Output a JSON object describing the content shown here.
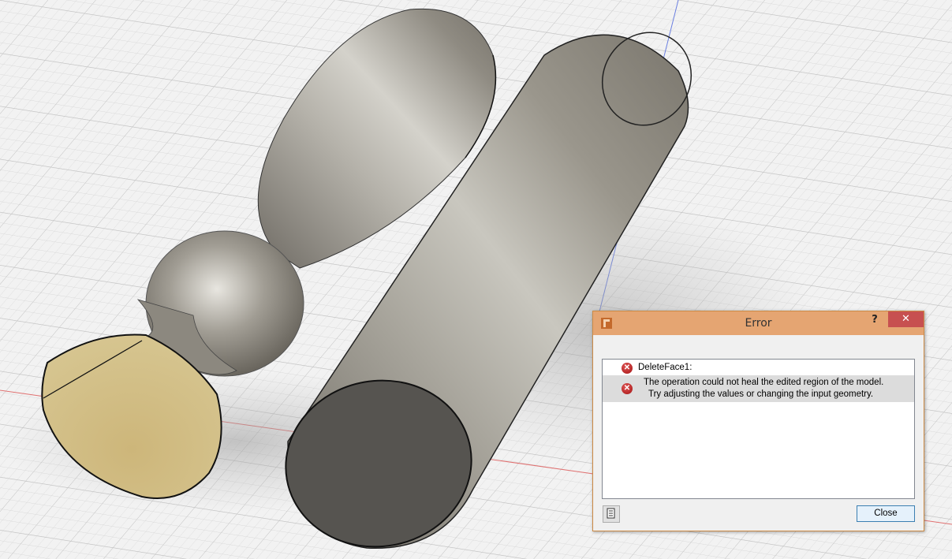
{
  "dialog": {
    "title": "Error",
    "help_label": "?",
    "close_x_label": "✕",
    "messages": [
      {
        "icon": "error-icon",
        "text": "DeleteFace1:"
      },
      {
        "icon": "error-icon",
        "line1": "The operation could not heal the edited region of the model.",
        "line2": "Try adjusting the values or changing the input geometry."
      }
    ],
    "close_label": "Close"
  },
  "colors": {
    "titlebar": "#e5a572",
    "close_x": "#c75050",
    "error_red": "#c41e1e",
    "face_fill": "#d0bc82",
    "cap_fill": "#565450"
  }
}
